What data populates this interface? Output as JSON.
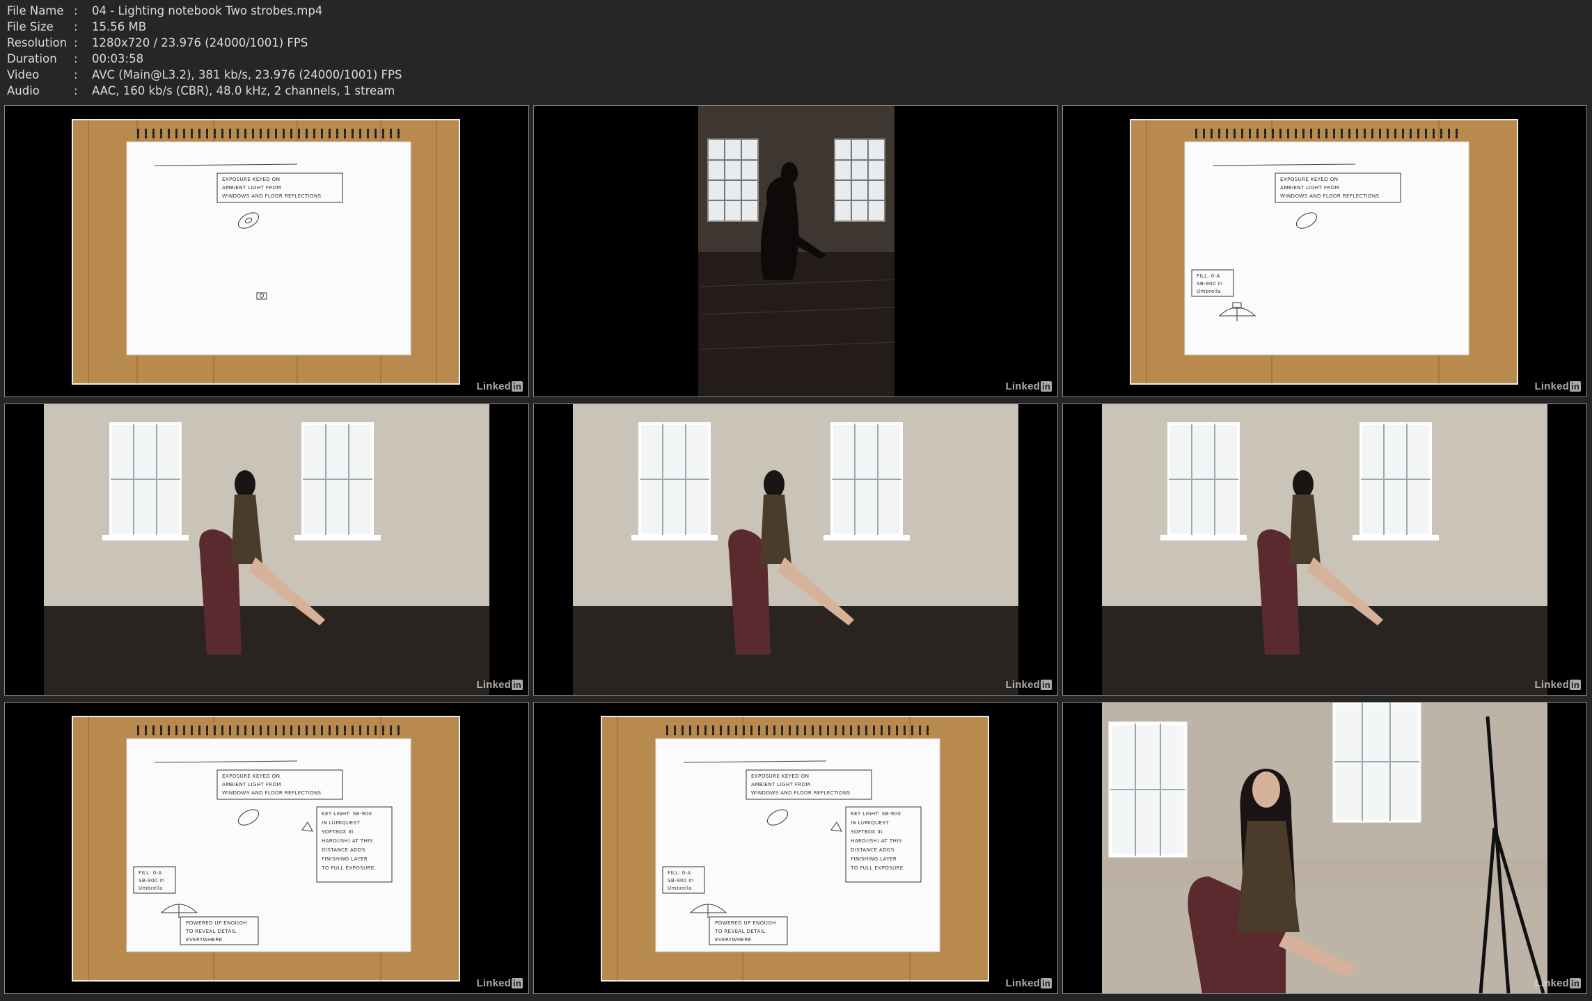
{
  "file_info": {
    "rows": [
      {
        "label": "File Name",
        "value": "04 - Lighting notebook Two strobes.mp4"
      },
      {
        "label": "File Size",
        "value": "15.56 MB"
      },
      {
        "label": "Resolution",
        "value": "1280x720 / 23.976 (24000/1001) FPS"
      },
      {
        "label": "Duration",
        "value": "00:03:58"
      },
      {
        "label": "Video",
        "value": "AVC (Main@L3.2), 381 kb/s, 23.976 (24000/1001) FPS"
      },
      {
        "label": "Audio",
        "value": "AAC, 160 kb/s (CBR), 48.0 kHz, 2 channels, 1 stream"
      }
    ],
    "separator": ":"
  },
  "watermark": {
    "text": "Linked",
    "box": "in"
  },
  "notebook": {
    "exposure_note": [
      "EXPOSURE KEYED ON",
      "AMBIENT LIGHT FROM",
      "WINDOWS AND FLOOR REFLECTIONS"
    ],
    "fill_note": [
      "FILL: 0-A",
      "SB-900 in",
      "Umbrella"
    ],
    "key_note": [
      "KEY LIGHT: SB-900",
      "IN LUMIQUEST",
      "SOFTBOX III.",
      "HARD(ISH) AT THIS",
      "DISTANCE ADDS",
      "FINISHING LAYER",
      "TO FULL EXPOSURE."
    ],
    "powered_note": [
      "POWERED UP ENOUGH",
      "TO REVEAL DETAIL",
      "EVERYWHERE"
    ]
  },
  "colors": {
    "background": "#262626",
    "thumb_border": "#8a8a8a",
    "wood": "#b98a4e",
    "paper": "#fbfbfb",
    "wall": "#c9c3b8",
    "floor": "#2a2420",
    "chair": "#5a2a2e"
  }
}
